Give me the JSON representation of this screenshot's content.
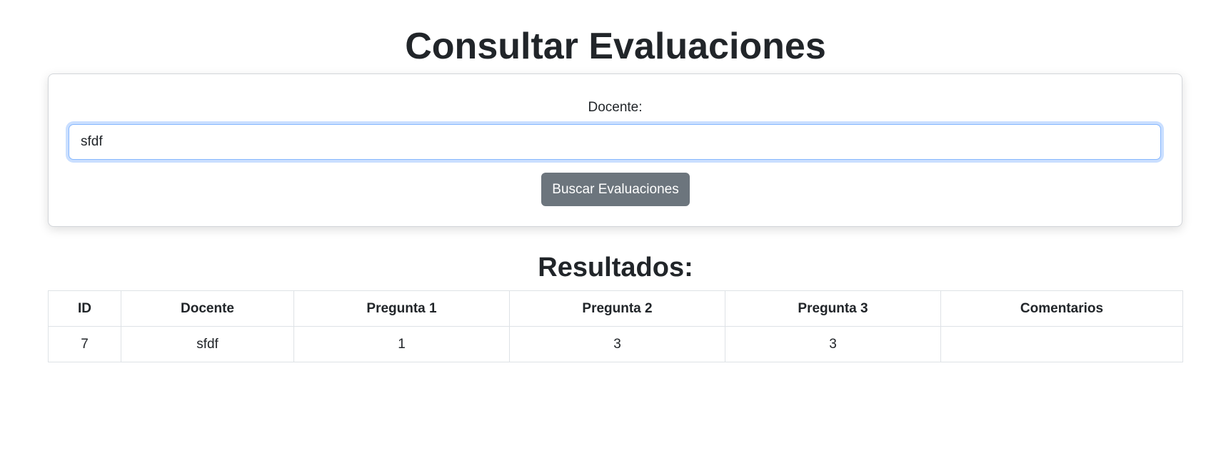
{
  "page": {
    "title": "Consultar Evaluaciones"
  },
  "search": {
    "label": "Docente:",
    "value": "sfdf",
    "button_label": "Buscar Evaluaciones"
  },
  "results": {
    "title": "Resultados:",
    "columns": [
      "ID",
      "Docente",
      "Pregunta 1",
      "Pregunta 2",
      "Pregunta 3",
      "Comentarios"
    ],
    "rows": [
      [
        "7",
        "sfdf",
        "1",
        "3",
        "3",
        ""
      ]
    ]
  },
  "colors": {
    "button_bg": "#6c757d",
    "input_focus_border": "#86b7fe",
    "text": "#212529"
  }
}
